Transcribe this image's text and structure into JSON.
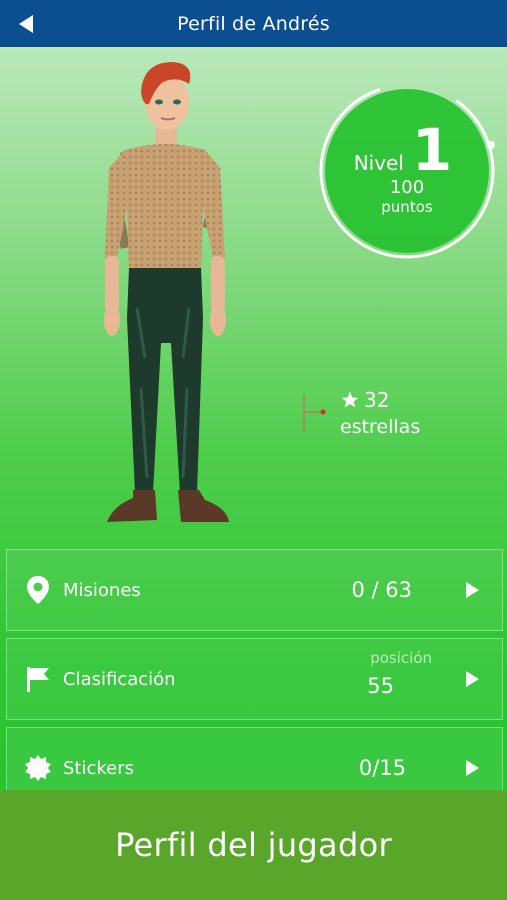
{
  "header": {
    "title": "Perfil de Andrés",
    "back_icon": "back-arrow-icon",
    "background": "#0c4f91"
  },
  "level": {
    "label": "Nivel",
    "number": "1",
    "points": "100",
    "points_label": "puntos",
    "progress": 0.02
  },
  "stars": {
    "count": "32",
    "label": "estrellas",
    "icon": "star-icon"
  },
  "rows": {
    "missions": {
      "label": "Misiones",
      "value": "0 / 63",
      "icon": "location-pin-icon"
    },
    "ranking": {
      "label": "Clasificación",
      "sub_label": "posición",
      "value": "55",
      "icon": "flag-icon"
    },
    "stickers": {
      "label": "Stickers",
      "value": "0/15",
      "icon": "sticker-badge-icon"
    }
  },
  "footer": {
    "text": "Perfil del jugador",
    "background": "#5aa62a"
  }
}
